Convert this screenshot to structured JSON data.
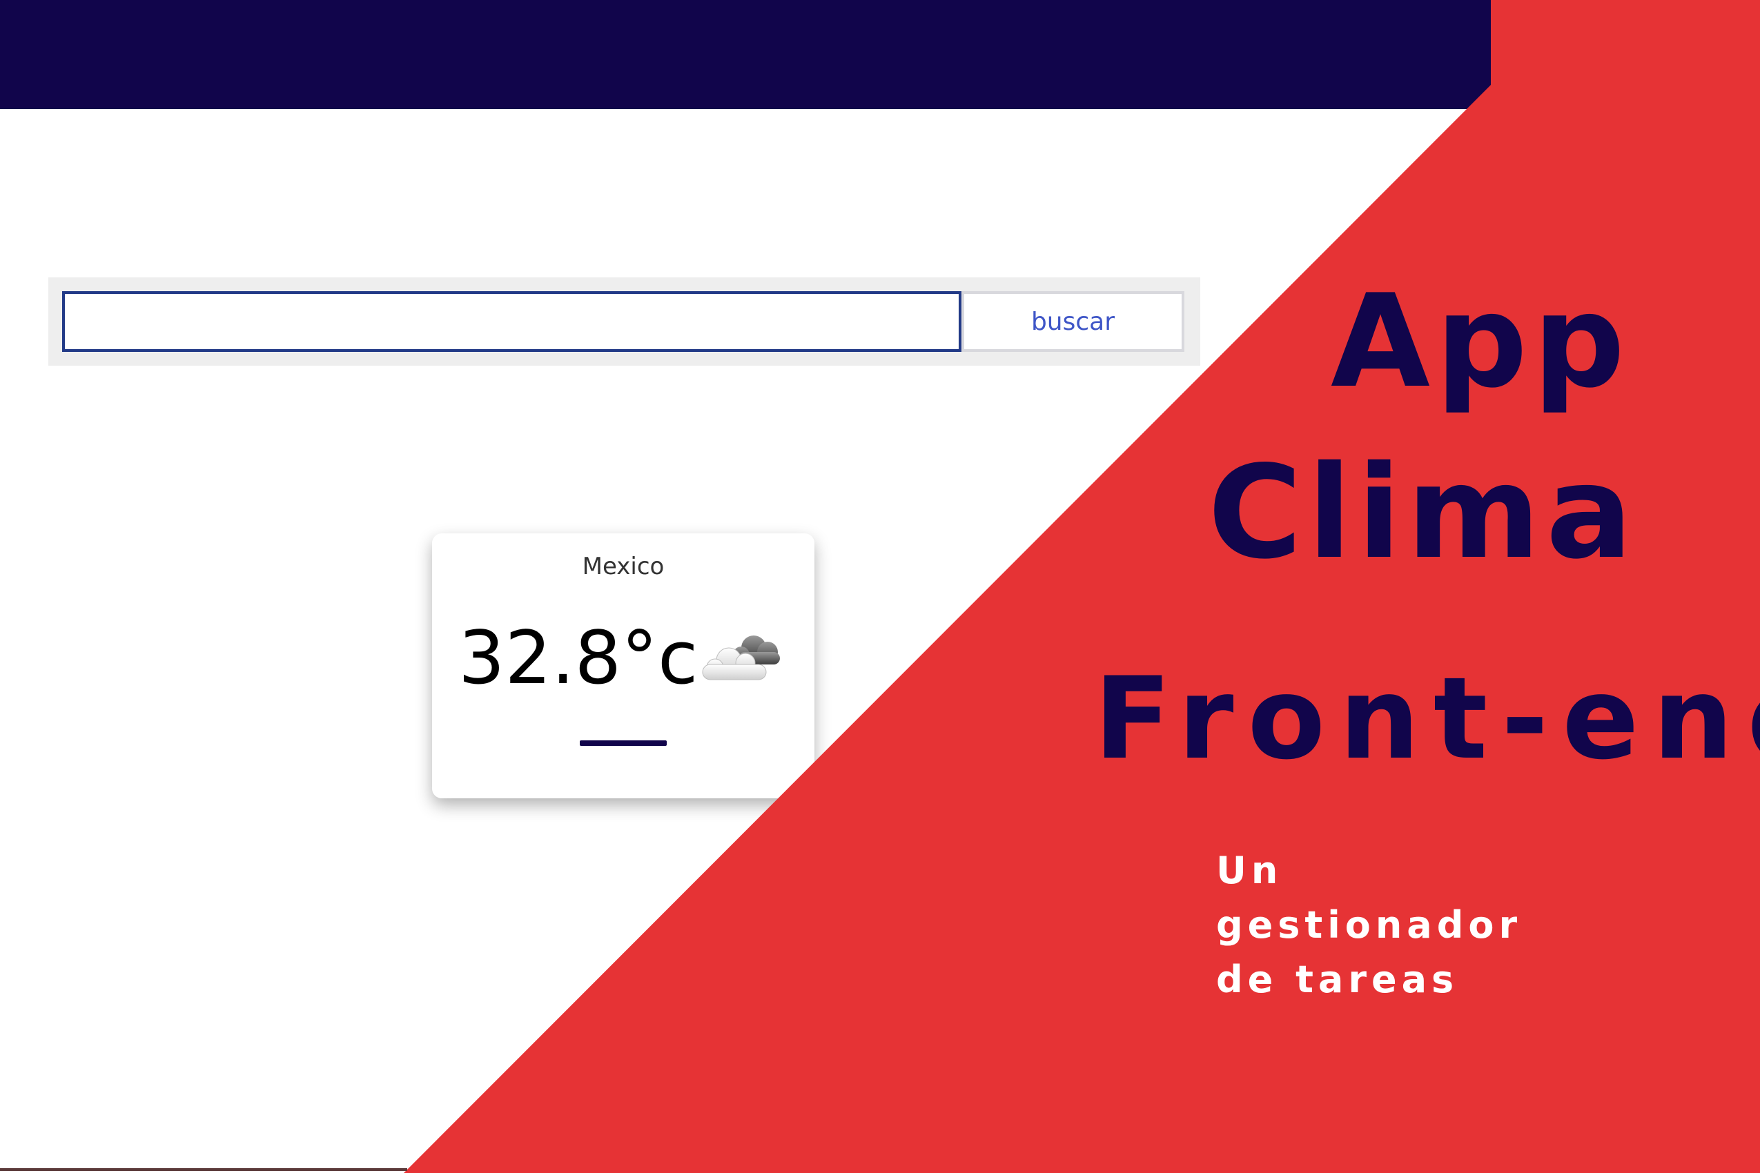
{
  "search": {
    "value": "",
    "placeholder": "",
    "button_label": "buscar"
  },
  "weather": {
    "city": "Mexico",
    "temperature": "32.8°c",
    "icon": "cloud-icon"
  },
  "title": {
    "line1": "App",
    "line2": "Clima",
    "line3": "Front-end"
  },
  "subtitle": {
    "line1": "Un",
    "line2": "gestionador",
    "line3": "de tareas"
  },
  "colors": {
    "navy": "#11054b",
    "red": "#e63335",
    "button_text": "#3f56c7",
    "input_border": "#223a87"
  }
}
